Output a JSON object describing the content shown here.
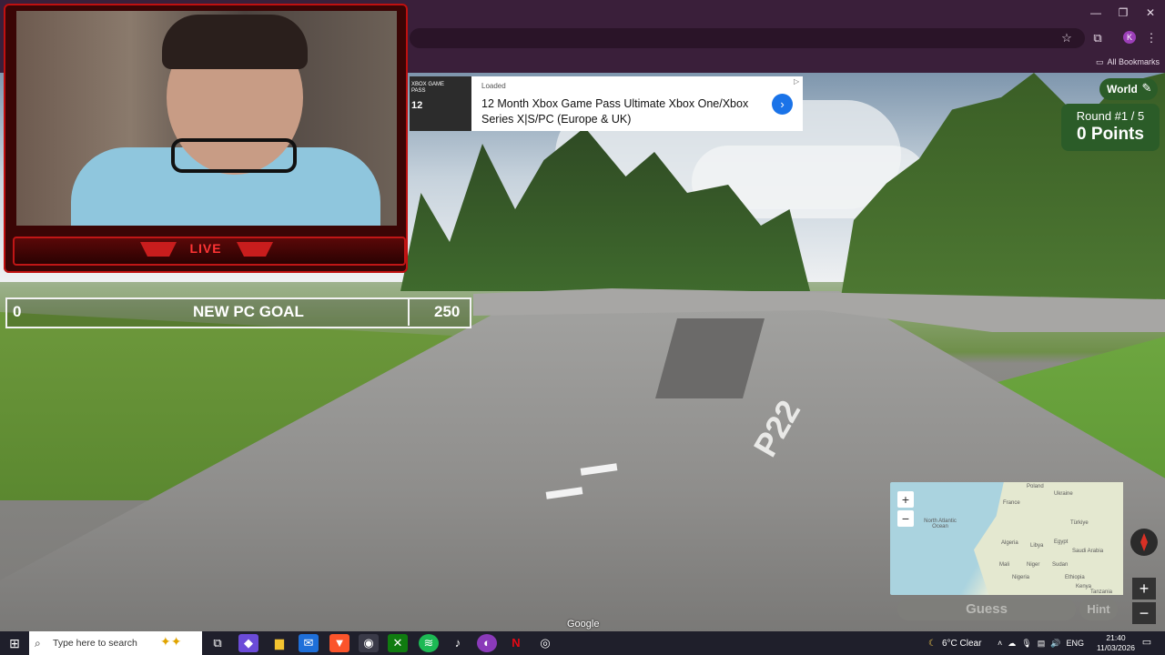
{
  "browser": {
    "window_controls": {
      "minimize": "—",
      "restore": "❐",
      "close": "✕"
    },
    "toolbar": {
      "star_icon": "star-icon",
      "extensions_icon": "puzzle-icon",
      "menu_icon": "kebab-icon",
      "profile_initial": "K"
    },
    "bookmarks": {
      "all_bookmarks": "All Bookmarks"
    }
  },
  "ad": {
    "status": "Loaded",
    "title": "12 Month Xbox Game Pass Ultimate Xbox One/Xbox Series X|S/PC (Europe & UK)",
    "thumb_label": "XBOX GAME PASS",
    "thumb_number": "12",
    "cta_icon": "chevron-right-icon"
  },
  "stream": {
    "live_label": "LIVE",
    "goal": {
      "start": "0",
      "title": "NEW PC GOAL",
      "end": "250"
    }
  },
  "game": {
    "map_mode": "World",
    "round": "Round #1 / 5",
    "points": "0 Points",
    "guess_label": "Guess",
    "hint_label": "Hint",
    "zoom_in": "+",
    "zoom_out": "−",
    "road_marking": "P22",
    "attribution": "Google",
    "map_labels": [
      "Poland",
      "Ukraine",
      "France",
      "North Atlantic Ocean",
      "Türkiye",
      "Algeria",
      "Libya",
      "Egypt",
      "Saudi Arabia",
      "Mali",
      "Niger",
      "Sudan",
      "Nigeria",
      "Ethiopia",
      "Kenya",
      "Tanzania"
    ]
  },
  "taskbar": {
    "search_placeholder": "Type here to search",
    "weather": "6°C  Clear",
    "language": "ENG",
    "time": "21:40",
    "date": "11/03/2026"
  }
}
